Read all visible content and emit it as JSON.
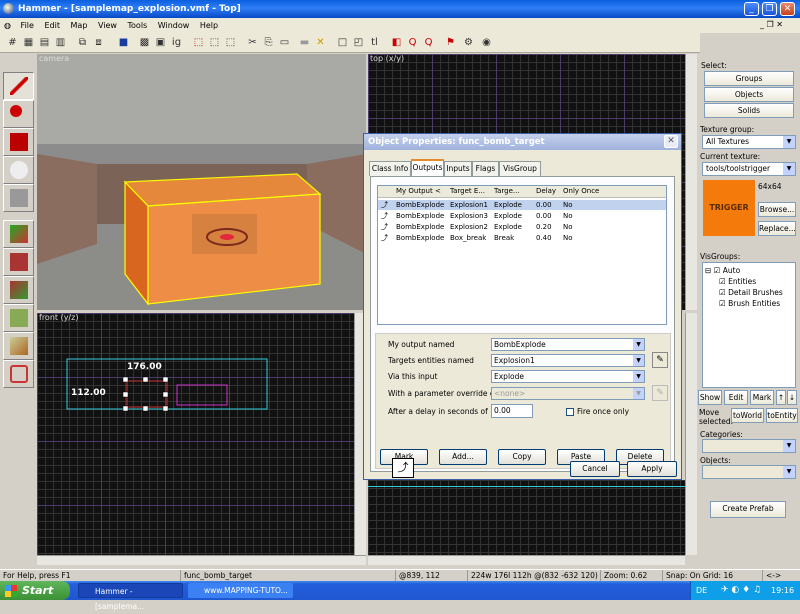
{
  "window": {
    "title": "Hammer - [samplemap_explosion.vmf - Top]",
    "min": "_",
    "max": "❐",
    "close": "✕"
  },
  "menu": [
    "File",
    "Edit",
    "Map",
    "View",
    "Tools",
    "Window",
    "Help"
  ],
  "viewports": {
    "camera": "camera",
    "top": "top (x/y)",
    "front": "front (y/z)"
  },
  "front_view": {
    "width_label": "176.00",
    "height_label": "112.00"
  },
  "right_panel": {
    "select_label": "Select:",
    "groups": "Groups",
    "objects": "Objects",
    "solids": "Solids",
    "texture_group_label": "Texture group:",
    "texture_group_value": "All Textures",
    "current_texture_label": "Current texture:",
    "current_texture_value": "tools/toolstrigger",
    "texture_preview_text": "TRIGGER",
    "texture_size": "64x64",
    "browse": "Browse...",
    "replace": "Replace...",
    "visgroups_label": "VisGroups:",
    "visgroups": {
      "auto": "Auto",
      "items": [
        "Entities",
        "Detail Brushes",
        "Brush Entities"
      ]
    },
    "show": "Show",
    "edit": "Edit",
    "mark": "Mark",
    "move_selected": "Move\nselected:",
    "to_world": "toWorld",
    "to_entity": "toEntity",
    "categories_label": "Categories:",
    "objects_label": "Objects:",
    "create_prefab": "Create Prefab"
  },
  "dialog": {
    "title": "Object Properties: func_bomb_target",
    "tabs": [
      "Class Info",
      "Outputs",
      "Inputs",
      "Flags",
      "VisGroup"
    ],
    "columns": [
      "My Output <",
      "Target E...",
      "Targe...",
      "Delay",
      "Only Once"
    ],
    "rows": [
      [
        "BombExplode",
        "Explosion1",
        "Explode",
        "0.00",
        "No"
      ],
      [
        "BombExplode",
        "Explosion3",
        "Explode",
        "0.00",
        "No"
      ],
      [
        "BombExplode",
        "Explosion2",
        "Explode",
        "0.20",
        "No"
      ],
      [
        "BombExplode",
        "Box_break",
        "Break",
        "0.40",
        "No"
      ]
    ],
    "fields": {
      "my_output_label": "My output named",
      "my_output_value": "BombExplode",
      "targets_label": "Targets entities named",
      "targets_value": "Explosion1",
      "via_input_label": "Via this input",
      "via_input_value": "Explode",
      "override_label": "With a parameter override of",
      "override_value": "<none>",
      "delay_label": "After a delay in seconds of",
      "delay_value": "0.00",
      "fire_once_label": "Fire once only"
    },
    "buttons": {
      "mark": "Mark",
      "add": "Add...",
      "copy": "Copy",
      "paste": "Paste",
      "delete": "Delete",
      "cancel": "Cancel",
      "apply": "Apply"
    }
  },
  "status": {
    "help": "For Help, press F1",
    "entity": "func_bomb_target",
    "coords": "@839, 112",
    "size": "224w 176l 112h @(832 -632 120)",
    "zoom": "Zoom: 0.62",
    "snap": "Snap: On Grid: 16",
    "extra": "<->"
  },
  "taskbar": {
    "start": "Start",
    "item1": "Hammer - [samplema...",
    "item2": "www.MAPPING-TUTO...",
    "lang": "DE",
    "time": "19:16"
  }
}
